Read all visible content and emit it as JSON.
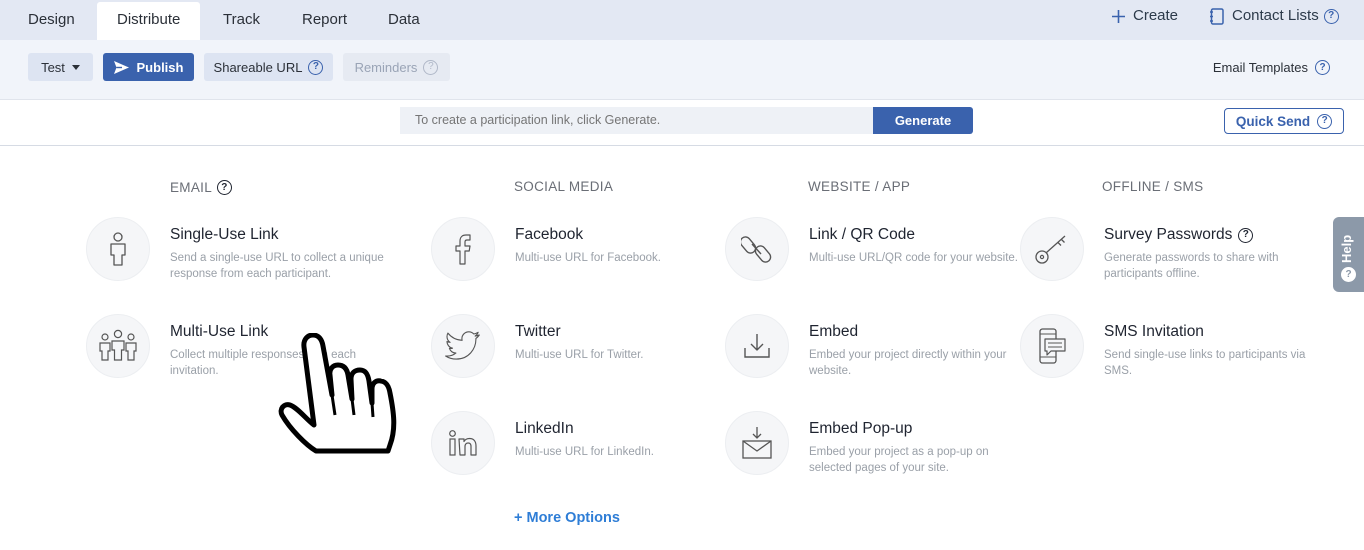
{
  "tabs": [
    {
      "label": "Design",
      "active": false
    },
    {
      "label": "Distribute",
      "active": true
    },
    {
      "label": "Track",
      "active": false
    },
    {
      "label": "Report",
      "active": false
    },
    {
      "label": "Data",
      "active": false
    }
  ],
  "top_actions": {
    "create_label": "Create",
    "contact_lists_label": "Contact Lists",
    "help_glyph": "?"
  },
  "toolbar": {
    "test_label": "Test",
    "publish_label": "Publish",
    "shareable_url_label": "Shareable URL",
    "reminders_label": "Reminders",
    "email_templates_label": "Email Templates"
  },
  "generate": {
    "placeholder": "To create a participation link, click Generate.",
    "button_label": "Generate",
    "quick_send_label": "Quick Send"
  },
  "columns": {
    "email": {
      "heading": "EMAIL",
      "items": [
        {
          "title": "Single-Use Link",
          "desc": "Send a single-use URL to collect a unique response from each participant.",
          "icon": "person-icon"
        },
        {
          "title": "Multi-Use Link",
          "desc": "Collect multiple responses with each invitation.",
          "icon": "group-icon"
        }
      ]
    },
    "social": {
      "heading": "SOCIAL MEDIA",
      "items": [
        {
          "title": "Facebook",
          "desc": "Multi-use URL for Facebook.",
          "icon": "facebook-icon"
        },
        {
          "title": "Twitter",
          "desc": "Multi-use URL for Twitter.",
          "icon": "twitter-icon"
        },
        {
          "title": "LinkedIn",
          "desc": "Multi-use URL for LinkedIn.",
          "icon": "linkedin-icon"
        }
      ]
    },
    "website": {
      "heading": "WEBSITE / APP",
      "items": [
        {
          "title": "Link / QR Code",
          "desc": "Multi-use URL/QR code for your website.",
          "icon": "link-icon"
        },
        {
          "title": "Embed",
          "desc": "Embed your project directly within your website.",
          "icon": "download-icon"
        },
        {
          "title": "Embed Pop-up",
          "desc": "Embed your project as a pop-up on selected pages of your site.",
          "icon": "envelope-download-icon"
        }
      ]
    },
    "offline": {
      "heading": "OFFLINE / SMS",
      "items": [
        {
          "title": "Survey Passwords",
          "desc": "Generate passwords to share with participants offline.",
          "icon": "key-icon"
        },
        {
          "title": "SMS Invitation",
          "desc": "Send single-use links to participants via SMS.",
          "icon": "phone-sms-icon"
        }
      ]
    }
  },
  "more_options_label": "+ More Options",
  "help_tab_label": "Help",
  "colors": {
    "primary": "#3a62ad",
    "tab_bar": "#e3e8f3",
    "toolbar": "#f1f4fa",
    "link": "#2e7dd6"
  }
}
